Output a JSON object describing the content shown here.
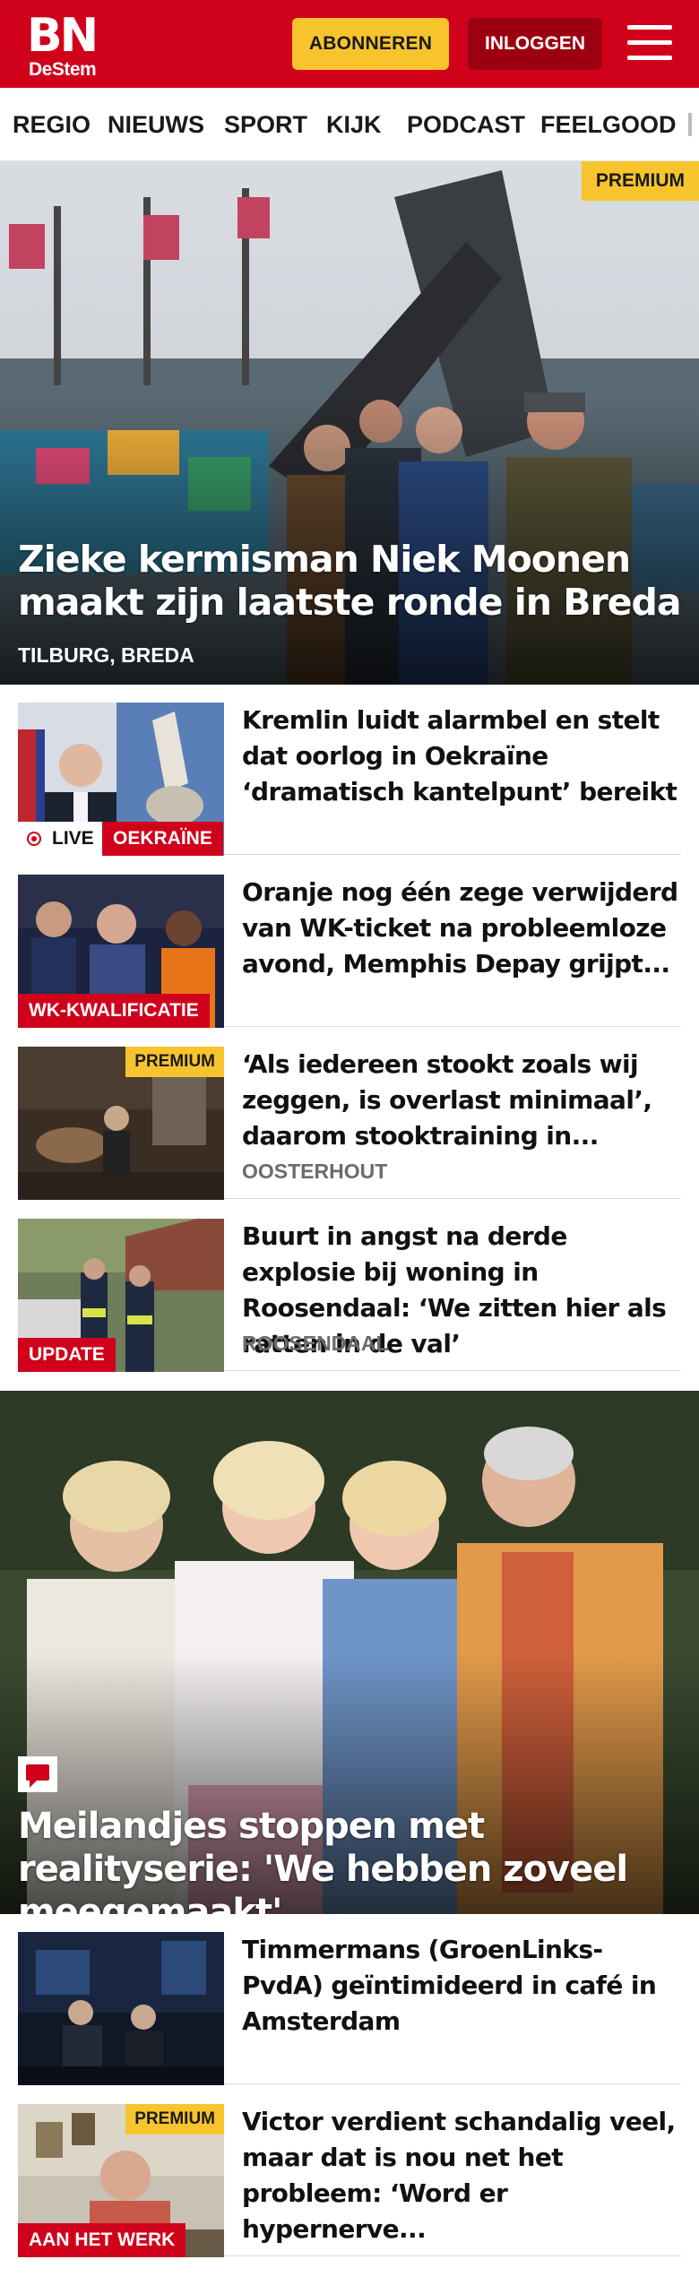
{
  "header": {
    "logo_main": "BN",
    "logo_sub": "DeStem",
    "subscribe_label": "ABONNEREN",
    "login_label": "INLOGGEN",
    "brand_color": "#d0021b",
    "accent_color": "#f8c42d"
  },
  "nav": {
    "items": [
      "REGIO",
      "NIEUWS",
      "SPORT",
      "KIJK",
      "PODCAST",
      "FEELGOOD"
    ]
  },
  "hero": {
    "badge": "PREMIUM",
    "title": "Zieke kermisman Niek Moonen maakt zijn laatste ronde in Breda",
    "location": "TILBURG, BREDA"
  },
  "articles": [
    {
      "title": "Kremlin luidt alarmbel en stelt dat oorlog in Oekraïne ‘dramatisch kantelpunt’ bereikt",
      "live_label": "LIVE",
      "tag": "OEKRAÏNE"
    },
    {
      "title": "Oranje nog één zege verwijderd van WK-ticket na probleemloze avond, Memphis Depay grijpt...",
      "tag": "WK-KWALIFICATIE"
    },
    {
      "title": "‘Als iedereen stookt zoals wij zeggen, is overlast minimaal’, daarom stooktraining in...",
      "badge": "PREMIUM",
      "location": "OOSTERHOUT"
    },
    {
      "title": "Buurt in angst na derde explosie bij woning in Roosendaal: ‘We zitten hier als ratten in de val’",
      "tag": "UPDATE",
      "location": "ROOSENDAAL"
    }
  ],
  "hero2": {
    "title": "Meilandjes stoppen met realityserie: 'We hebben zoveel meegemaakt'",
    "icon": "comment-icon"
  },
  "articles2": [
    {
      "title": "Timmermans (GroenLinks-PvdA) geïntimideerd in café in Amsterdam"
    },
    {
      "title": "Victor verdient schandalig veel, maar dat is nou net het probleem: ‘Word er hypernerve...",
      "badge": "PREMIUM",
      "tag": "AAN HET WERK"
    }
  ]
}
